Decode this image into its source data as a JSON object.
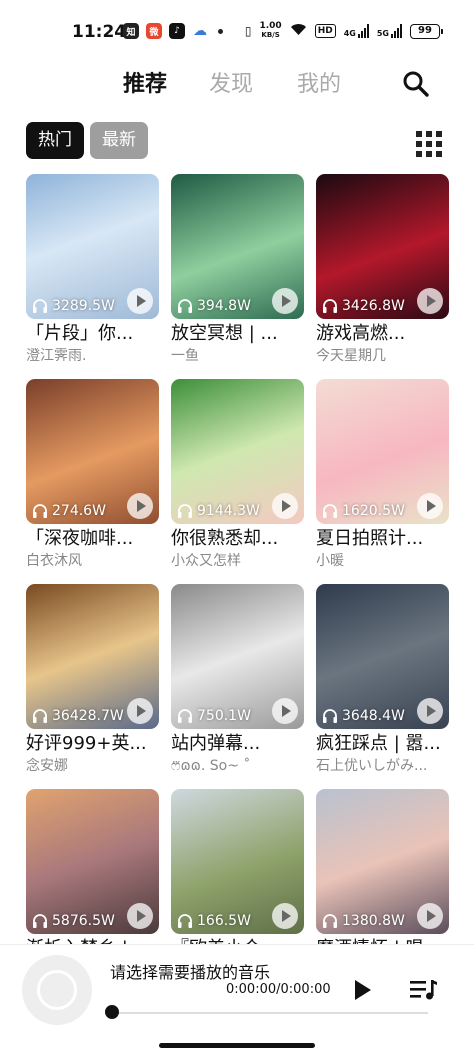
{
  "status": {
    "time": "11:24",
    "speed_top": "1.00",
    "speed_bottom": "KB/S",
    "hd": "HD",
    "net1": "4G",
    "net2": "5G",
    "battery": "99"
  },
  "tabs": [
    {
      "label": "推荐"
    },
    {
      "label": "发现"
    },
    {
      "label": "我的"
    }
  ],
  "filters": {
    "hot": "热门",
    "new": "最新"
  },
  "icons": {
    "search": "search-icon",
    "grid": "grid-view-icon",
    "play": "play-icon",
    "playlist": "playlist-icon",
    "headphone": "headphone-icon"
  },
  "cards": [
    {
      "plays": "3289.5W",
      "title": "「片段」你...",
      "author": "澄江霁雨."
    },
    {
      "plays": "394.8W",
      "title": "放空冥想 | ...",
      "author": "一鱼"
    },
    {
      "plays": "3426.8W",
      "title": "游戏高燃...",
      "author": "今天星期几"
    },
    {
      "plays": "274.6W",
      "title": "「深夜咖啡...",
      "author": "白衣沐风"
    },
    {
      "plays": "9144.3W",
      "title": "你很熟悉却...",
      "author": "小众又怎样"
    },
    {
      "plays": "1620.5W",
      "title": "夏日拍照计...",
      "author": "小暖"
    },
    {
      "plays": "36428.7W",
      "title": "好评999+英...",
      "author": "念安娜"
    },
    {
      "plays": "750.1W",
      "title": "站内弹幕...",
      "author": "ෆ⃛ɷɷ. So~ ˚"
    },
    {
      "plays": "3648.4W",
      "title": "疯狂踩点 | 嚣...",
      "author": "石上优いしがみ..."
    },
    {
      "plays": "5876.5W",
      "title": "渐析入梦乡 | ...",
      "author": ""
    },
    {
      "plays": "166.5W",
      "title": "『欧美小众...",
      "author": ""
    },
    {
      "plays": "1380.8W",
      "title": "魔酒情怀 | 唱...",
      "author": ""
    }
  ],
  "player": {
    "title": "请选择需要播放的音乐",
    "time": "0:00:00/0:00:00",
    "progress": 0
  }
}
